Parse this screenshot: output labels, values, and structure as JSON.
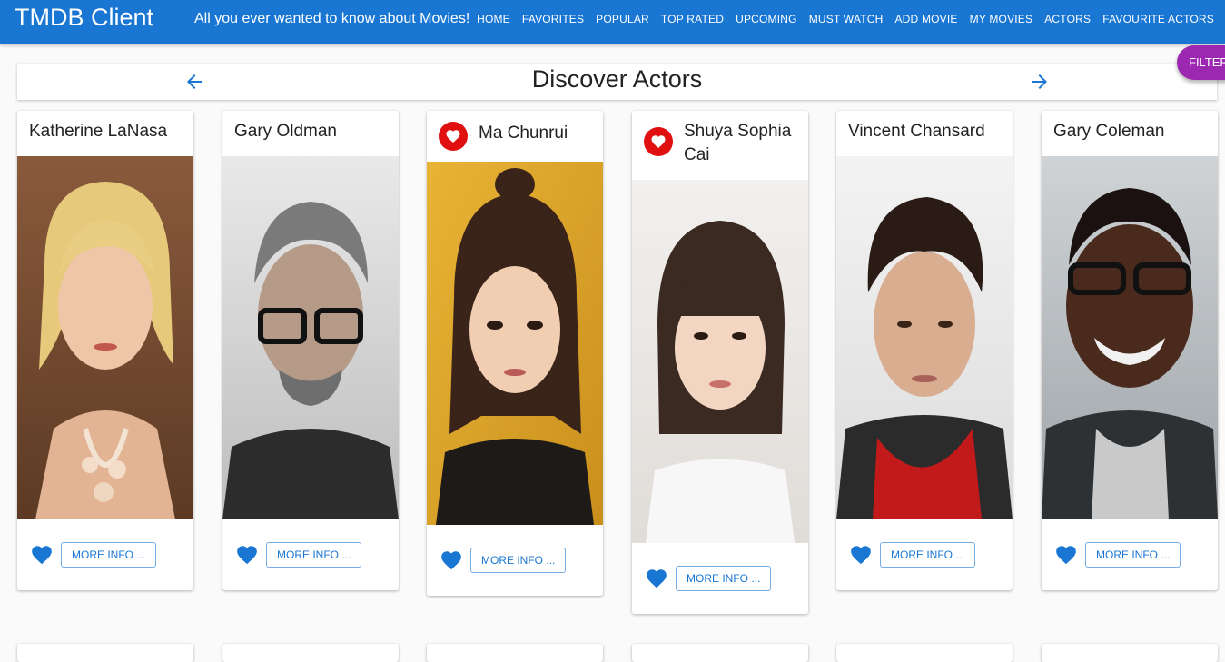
{
  "app": {
    "title": "TMDB Client",
    "tagline": "All you ever wanted to know about Movies!",
    "nav": [
      "HOME",
      "FAVORITES",
      "POPULAR",
      "TOP RATED",
      "UPCOMING",
      "MUST WATCH",
      "ADD MOVIE",
      "MY MOVIES",
      "ACTORS",
      "FAVOURITE ACTORS"
    ]
  },
  "page": {
    "title": "Discover Actors",
    "filter_label": "FILTER"
  },
  "actors": [
    {
      "name": "Katherine LaNasa",
      "favorite": false,
      "more_label": "MORE INFO ..."
    },
    {
      "name": "Gary Oldman",
      "favorite": false,
      "more_label": "MORE INFO ..."
    },
    {
      "name": "Ma Chunrui",
      "favorite": true,
      "more_label": "MORE INFO ..."
    },
    {
      "name": "Shuya Sophia Cai",
      "favorite": true,
      "more_label": "MORE INFO ..."
    },
    {
      "name": "Vincent Chansard",
      "favorite": false,
      "more_label": "MORE INFO ..."
    },
    {
      "name": "Gary Coleman",
      "favorite": false,
      "more_label": "MORE INFO ..."
    }
  ],
  "colors": {
    "appbar": "#1976d2",
    "accent": "#1976d2",
    "favorite_badge": "#e01010",
    "filter_button": "#9c27b0"
  }
}
